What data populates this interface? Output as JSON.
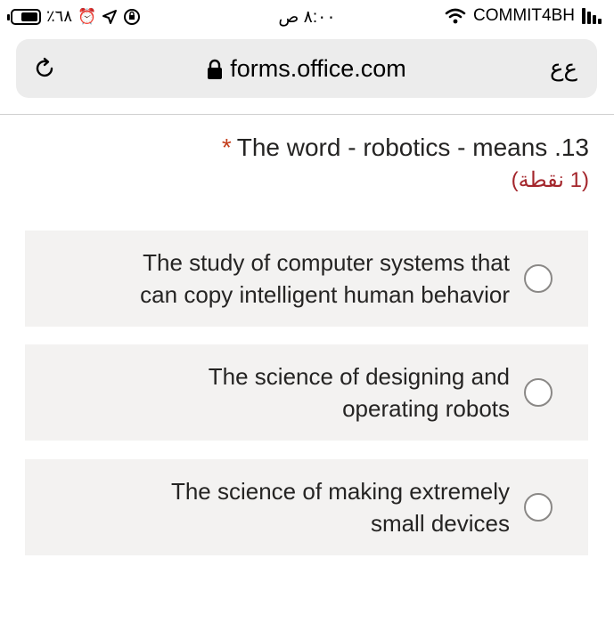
{
  "status_bar": {
    "battery_percent": "٪٦٨",
    "battery_level": 0.68,
    "time": "٨:٠٠ ص",
    "carrier": "COMMIT4BH",
    "icons": [
      "battery-icon",
      "alarm-icon",
      "location-arrow-icon",
      "orientation-lock-icon",
      "wifi-icon",
      "signal-bars-icon"
    ]
  },
  "browser": {
    "url": "forms.office.com",
    "text_size_label": "ﻉﻉ",
    "icons": [
      "reload-icon",
      "lock-icon"
    ]
  },
  "question": {
    "required_mark": "*",
    "title": "The word - robotics - means .13",
    "points": "(1 نقطة)"
  },
  "options": [
    {
      "line1": "The study of computer systems that",
      "line2": "can copy intelligent human behavior",
      "selected": false
    },
    {
      "line1": "The science of designing and",
      "line2": "operating robots",
      "selected": false
    },
    {
      "line1": "The science of making extremely",
      "line2": "small devices",
      "selected": false
    }
  ],
  "colors": {
    "required": "#c43e1c",
    "points": "#a4262c",
    "option_bg": "#f3f2f1",
    "url_bar_bg": "#ececec"
  }
}
